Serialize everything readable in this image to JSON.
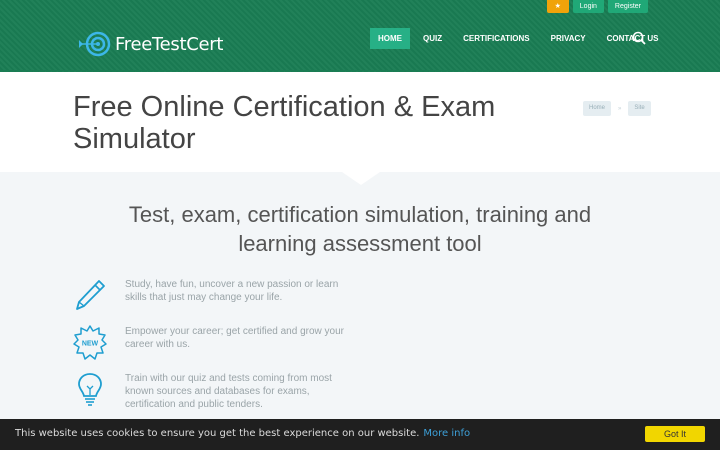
{
  "topbar": {
    "login": "Login",
    "register": "Register"
  },
  "brand": {
    "name": "FreeTestCert"
  },
  "nav": [
    "HOME",
    "QUIZ",
    "CERTIFICATIONS",
    "PRIVACY",
    "CONTACT US"
  ],
  "page": {
    "title": "Free Online Certification & Exam Simulator"
  },
  "breadcrumb": {
    "home": "Home",
    "current": "Site"
  },
  "main": {
    "heading": "Test, exam, certification simulation, training and learning assessment tool",
    "features": [
      {
        "icon": "pencil-icon",
        "text": "Study, have fun, uncover a new passion or learn skills that just may change your life."
      },
      {
        "icon": "new-badge-icon",
        "text": "Empower your career; get certified and grow your career with us."
      },
      {
        "icon": "lightbulb-icon",
        "text": "Train with our quiz and tests coming from most known sources and databases for exams, certification and public tenders."
      }
    ]
  },
  "cookie": {
    "message": "This website uses cookies to ensure you get the best experience on our website.",
    "more": "More info",
    "button": "Got It"
  },
  "colors": {
    "header": "#1a7d54",
    "accent": "#27b086",
    "star": "#f0a30a",
    "icon": "#1f9ed0",
    "cookie_button": "#f1d600"
  }
}
